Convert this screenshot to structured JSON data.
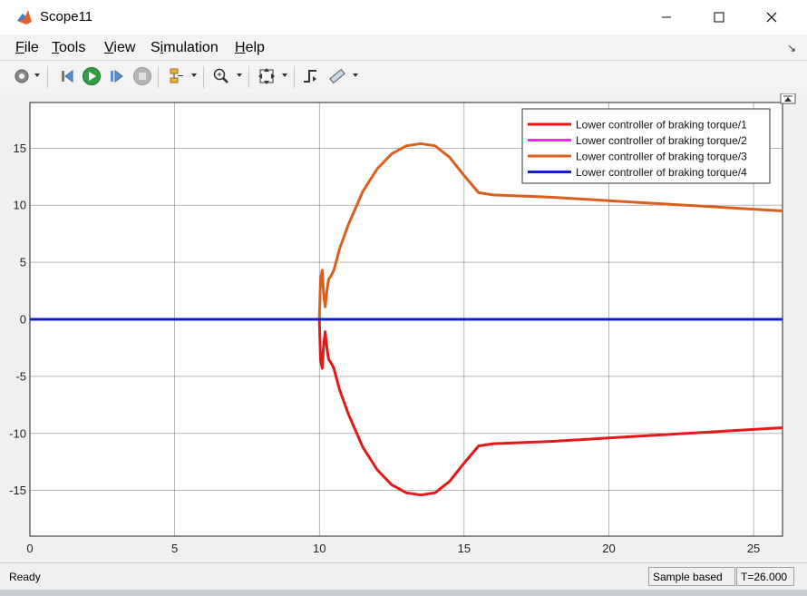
{
  "window": {
    "title": "Scope11"
  },
  "menu": {
    "file": {
      "u": "F",
      "rest": "ile"
    },
    "tools": {
      "u": "T",
      "rest": "ools"
    },
    "view": {
      "u": "V",
      "rest": "iew"
    },
    "simulation": {
      "pre": "S",
      "u": "i",
      "rest": "mulation"
    },
    "help": {
      "u": "H",
      "rest": "elp"
    }
  },
  "toolbar": {
    "icons": [
      "settings-icon",
      "step-back-icon",
      "run-icon",
      "step-forward-icon",
      "stop-icon",
      "highlight-block-icon",
      "zoom-in-icon",
      "fit-to-view-icon",
      "triggers-icon",
      "measurements-icon"
    ]
  },
  "status": {
    "ready": "Ready",
    "sample": "Sample based",
    "time": "T=26.000"
  },
  "chart_data": {
    "type": "line",
    "xlim": [
      0,
      26
    ],
    "ylim": [
      -19,
      19
    ],
    "xticks": [
      0,
      5,
      10,
      15,
      20,
      25
    ],
    "yticks": [
      -15,
      -10,
      -5,
      0,
      5,
      10,
      15
    ],
    "grid": true,
    "legend_position": "top-right",
    "series": [
      {
        "name": "Lower controller of braking torque/1",
        "color": "#e11919",
        "x": [
          0,
          10,
          10.04,
          10.1,
          10.14,
          10.2,
          10.26,
          10.32,
          10.4,
          10.5,
          10.7,
          11,
          11.5,
          12,
          12.5,
          13,
          13.5,
          14,
          14.5,
          15,
          15.5,
          16,
          18,
          20,
          22,
          24,
          26
        ],
        "y": [
          0,
          0,
          -3.5,
          -4.3,
          -2.5,
          -1.1,
          -2.5,
          -3.5,
          -3.8,
          -4.3,
          -6.2,
          -8.3,
          -11.2,
          -13.2,
          -14.5,
          -15.2,
          -15.4,
          -15.2,
          -14.2,
          -12.6,
          -11.1,
          -10.9,
          -10.7,
          -10.4,
          -10.1,
          -9.8,
          -9.5
        ]
      },
      {
        "name": "Lower controller of braking torque/2",
        "color": "#ff22ee",
        "x": [
          0,
          26
        ],
        "y": [
          0,
          0
        ]
      },
      {
        "name": "Lower controller of braking torque/3",
        "color": "#d95f1e",
        "x": [
          0,
          10,
          10.04,
          10.1,
          10.14,
          10.2,
          10.26,
          10.32,
          10.4,
          10.5,
          10.7,
          11,
          11.5,
          12,
          12.5,
          13,
          13.5,
          14,
          14.5,
          15,
          15.5,
          16,
          18,
          20,
          22,
          24,
          26
        ],
        "y": [
          0,
          0,
          3.5,
          4.3,
          2.5,
          1.1,
          2.5,
          3.5,
          3.8,
          4.3,
          6.2,
          8.3,
          11.2,
          13.2,
          14.5,
          15.2,
          15.4,
          15.2,
          14.2,
          12.6,
          11.1,
          10.9,
          10.7,
          10.4,
          10.1,
          9.8,
          9.5
        ]
      },
      {
        "name": "Lower controller of braking torque/4",
        "color": "#1020c8",
        "x": [
          0,
          26
        ],
        "y": [
          0,
          0
        ]
      }
    ]
  }
}
